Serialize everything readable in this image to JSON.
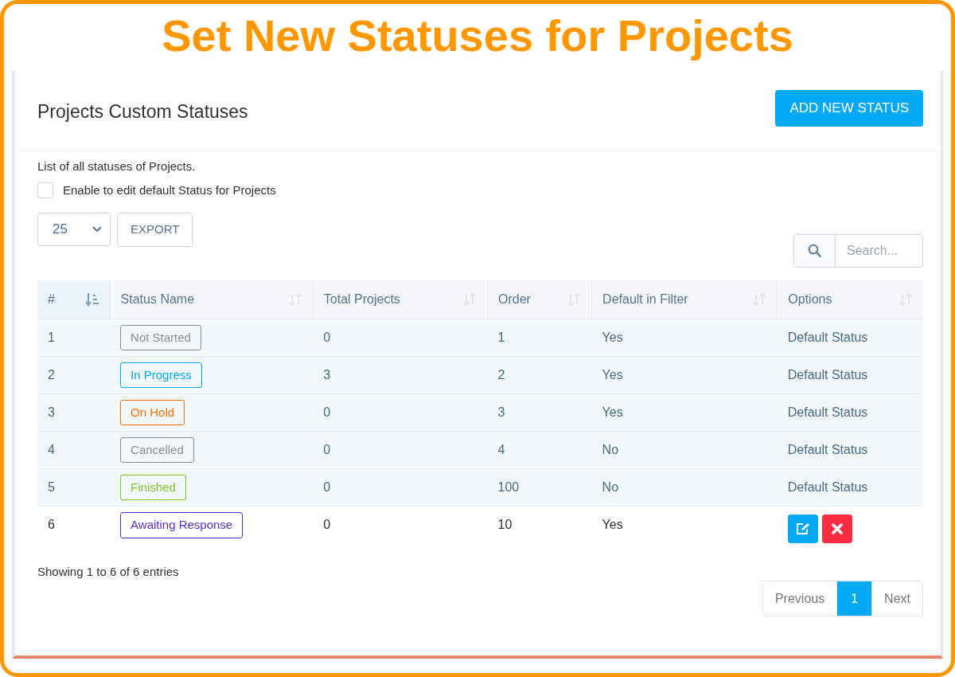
{
  "banner": {
    "title": "Set New Statuses for Projects"
  },
  "card": {
    "title": "Projects Custom Statuses",
    "add_button": "ADD NEW STATUS"
  },
  "description": "List of all statuses of Projects.",
  "enable_default_edit": {
    "label": "Enable to edit default Status for Projects",
    "checked": false
  },
  "page_size": {
    "value": "25"
  },
  "export_button": "EXPORT",
  "search": {
    "placeholder": "Search..."
  },
  "table": {
    "columns": [
      {
        "label": "#",
        "sorted": true
      },
      {
        "label": "Status Name",
        "sorted": false
      },
      {
        "label": "Total Projects",
        "sorted": false
      },
      {
        "label": "Order",
        "sorted": false
      },
      {
        "label": "Default in Filter",
        "sorted": false
      },
      {
        "label": "Options",
        "sorted": false
      }
    ],
    "rows": [
      {
        "number": "1",
        "status": "Not Started",
        "color": "#8a8f96",
        "total": "0",
        "order": "1",
        "default_in_filter": "Yes",
        "default": true,
        "options": "Default Status"
      },
      {
        "number": "2",
        "status": "In Progress",
        "color": "#03a9f4",
        "total": "3",
        "order": "2",
        "default_in_filter": "Yes",
        "default": true,
        "options": "Default Status"
      },
      {
        "number": "3",
        "status": "On Hold",
        "color": "#ff6f00",
        "total": "0",
        "order": "3",
        "default_in_filter": "Yes",
        "default": true,
        "options": "Default Status"
      },
      {
        "number": "4",
        "status": "Cancelled",
        "color": "#8a8f96",
        "total": "0",
        "order": "4",
        "default_in_filter": "No",
        "default": true,
        "options": "Default Status"
      },
      {
        "number": "5",
        "status": "Finished",
        "color": "#84c529",
        "total": "0",
        "order": "100",
        "default_in_filter": "No",
        "default": true,
        "options": "Default Status"
      },
      {
        "number": "6",
        "status": "Awaiting Response",
        "color": "#5b2fd6",
        "total": "0",
        "order": "10",
        "default_in_filter": "Yes",
        "default": false,
        "actions": [
          {
            "kind": "edit"
          },
          {
            "kind": "delete"
          }
        ]
      }
    ]
  },
  "footer": {
    "info": "Showing 1 to 6 of 6 entries"
  },
  "pagination": [
    {
      "label": "Previous",
      "selected": false
    },
    {
      "label": "1",
      "selected": true
    },
    {
      "label": "Next",
      "selected": false
    }
  ]
}
